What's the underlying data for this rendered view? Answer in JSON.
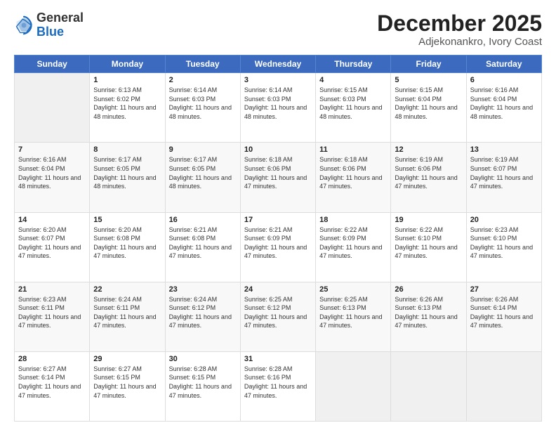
{
  "header": {
    "logo_general": "General",
    "logo_blue": "Blue",
    "month_title": "December 2025",
    "location": "Adjekonankro, Ivory Coast"
  },
  "calendar": {
    "days_of_week": [
      "Sunday",
      "Monday",
      "Tuesday",
      "Wednesday",
      "Thursday",
      "Friday",
      "Saturday"
    ],
    "weeks": [
      [
        {
          "day": "",
          "info": ""
        },
        {
          "day": "1",
          "info": "Sunrise: 6:13 AM\nSunset: 6:02 PM\nDaylight: 11 hours\nand 48 minutes."
        },
        {
          "day": "2",
          "info": "Sunrise: 6:14 AM\nSunset: 6:03 PM\nDaylight: 11 hours\nand 48 minutes."
        },
        {
          "day": "3",
          "info": "Sunrise: 6:14 AM\nSunset: 6:03 PM\nDaylight: 11 hours\nand 48 minutes."
        },
        {
          "day": "4",
          "info": "Sunrise: 6:15 AM\nSunset: 6:03 PM\nDaylight: 11 hours\nand 48 minutes."
        },
        {
          "day": "5",
          "info": "Sunrise: 6:15 AM\nSunset: 6:04 PM\nDaylight: 11 hours\nand 48 minutes."
        },
        {
          "day": "6",
          "info": "Sunrise: 6:16 AM\nSunset: 6:04 PM\nDaylight: 11 hours\nand 48 minutes."
        }
      ],
      [
        {
          "day": "7",
          "info": "Sunrise: 6:16 AM\nSunset: 6:04 PM\nDaylight: 11 hours\nand 48 minutes."
        },
        {
          "day": "8",
          "info": "Sunrise: 6:17 AM\nSunset: 6:05 PM\nDaylight: 11 hours\nand 48 minutes."
        },
        {
          "day": "9",
          "info": "Sunrise: 6:17 AM\nSunset: 6:05 PM\nDaylight: 11 hours\nand 48 minutes."
        },
        {
          "day": "10",
          "info": "Sunrise: 6:18 AM\nSunset: 6:06 PM\nDaylight: 11 hours\nand 47 minutes."
        },
        {
          "day": "11",
          "info": "Sunrise: 6:18 AM\nSunset: 6:06 PM\nDaylight: 11 hours\nand 47 minutes."
        },
        {
          "day": "12",
          "info": "Sunrise: 6:19 AM\nSunset: 6:06 PM\nDaylight: 11 hours\nand 47 minutes."
        },
        {
          "day": "13",
          "info": "Sunrise: 6:19 AM\nSunset: 6:07 PM\nDaylight: 11 hours\nand 47 minutes."
        }
      ],
      [
        {
          "day": "14",
          "info": "Sunrise: 6:20 AM\nSunset: 6:07 PM\nDaylight: 11 hours\nand 47 minutes."
        },
        {
          "day": "15",
          "info": "Sunrise: 6:20 AM\nSunset: 6:08 PM\nDaylight: 11 hours\nand 47 minutes."
        },
        {
          "day": "16",
          "info": "Sunrise: 6:21 AM\nSunset: 6:08 PM\nDaylight: 11 hours\nand 47 minutes."
        },
        {
          "day": "17",
          "info": "Sunrise: 6:21 AM\nSunset: 6:09 PM\nDaylight: 11 hours\nand 47 minutes."
        },
        {
          "day": "18",
          "info": "Sunrise: 6:22 AM\nSunset: 6:09 PM\nDaylight: 11 hours\nand 47 minutes."
        },
        {
          "day": "19",
          "info": "Sunrise: 6:22 AM\nSunset: 6:10 PM\nDaylight: 11 hours\nand 47 minutes."
        },
        {
          "day": "20",
          "info": "Sunrise: 6:23 AM\nSunset: 6:10 PM\nDaylight: 11 hours\nand 47 minutes."
        }
      ],
      [
        {
          "day": "21",
          "info": "Sunrise: 6:23 AM\nSunset: 6:11 PM\nDaylight: 11 hours\nand 47 minutes."
        },
        {
          "day": "22",
          "info": "Sunrise: 6:24 AM\nSunset: 6:11 PM\nDaylight: 11 hours\nand 47 minutes."
        },
        {
          "day": "23",
          "info": "Sunrise: 6:24 AM\nSunset: 6:12 PM\nDaylight: 11 hours\nand 47 minutes."
        },
        {
          "day": "24",
          "info": "Sunrise: 6:25 AM\nSunset: 6:12 PM\nDaylight: 11 hours\nand 47 minutes."
        },
        {
          "day": "25",
          "info": "Sunrise: 6:25 AM\nSunset: 6:13 PM\nDaylight: 11 hours\nand 47 minutes."
        },
        {
          "day": "26",
          "info": "Sunrise: 6:26 AM\nSunset: 6:13 PM\nDaylight: 11 hours\nand 47 minutes."
        },
        {
          "day": "27",
          "info": "Sunrise: 6:26 AM\nSunset: 6:14 PM\nDaylight: 11 hours\nand 47 minutes."
        }
      ],
      [
        {
          "day": "28",
          "info": "Sunrise: 6:27 AM\nSunset: 6:14 PM\nDaylight: 11 hours\nand 47 minutes."
        },
        {
          "day": "29",
          "info": "Sunrise: 6:27 AM\nSunset: 6:15 PM\nDaylight: 11 hours\nand 47 minutes."
        },
        {
          "day": "30",
          "info": "Sunrise: 6:28 AM\nSunset: 6:15 PM\nDaylight: 11 hours\nand 47 minutes."
        },
        {
          "day": "31",
          "info": "Sunrise: 6:28 AM\nSunset: 6:16 PM\nDaylight: 11 hours\nand 47 minutes."
        },
        {
          "day": "",
          "info": ""
        },
        {
          "day": "",
          "info": ""
        },
        {
          "day": "",
          "info": ""
        }
      ]
    ]
  }
}
